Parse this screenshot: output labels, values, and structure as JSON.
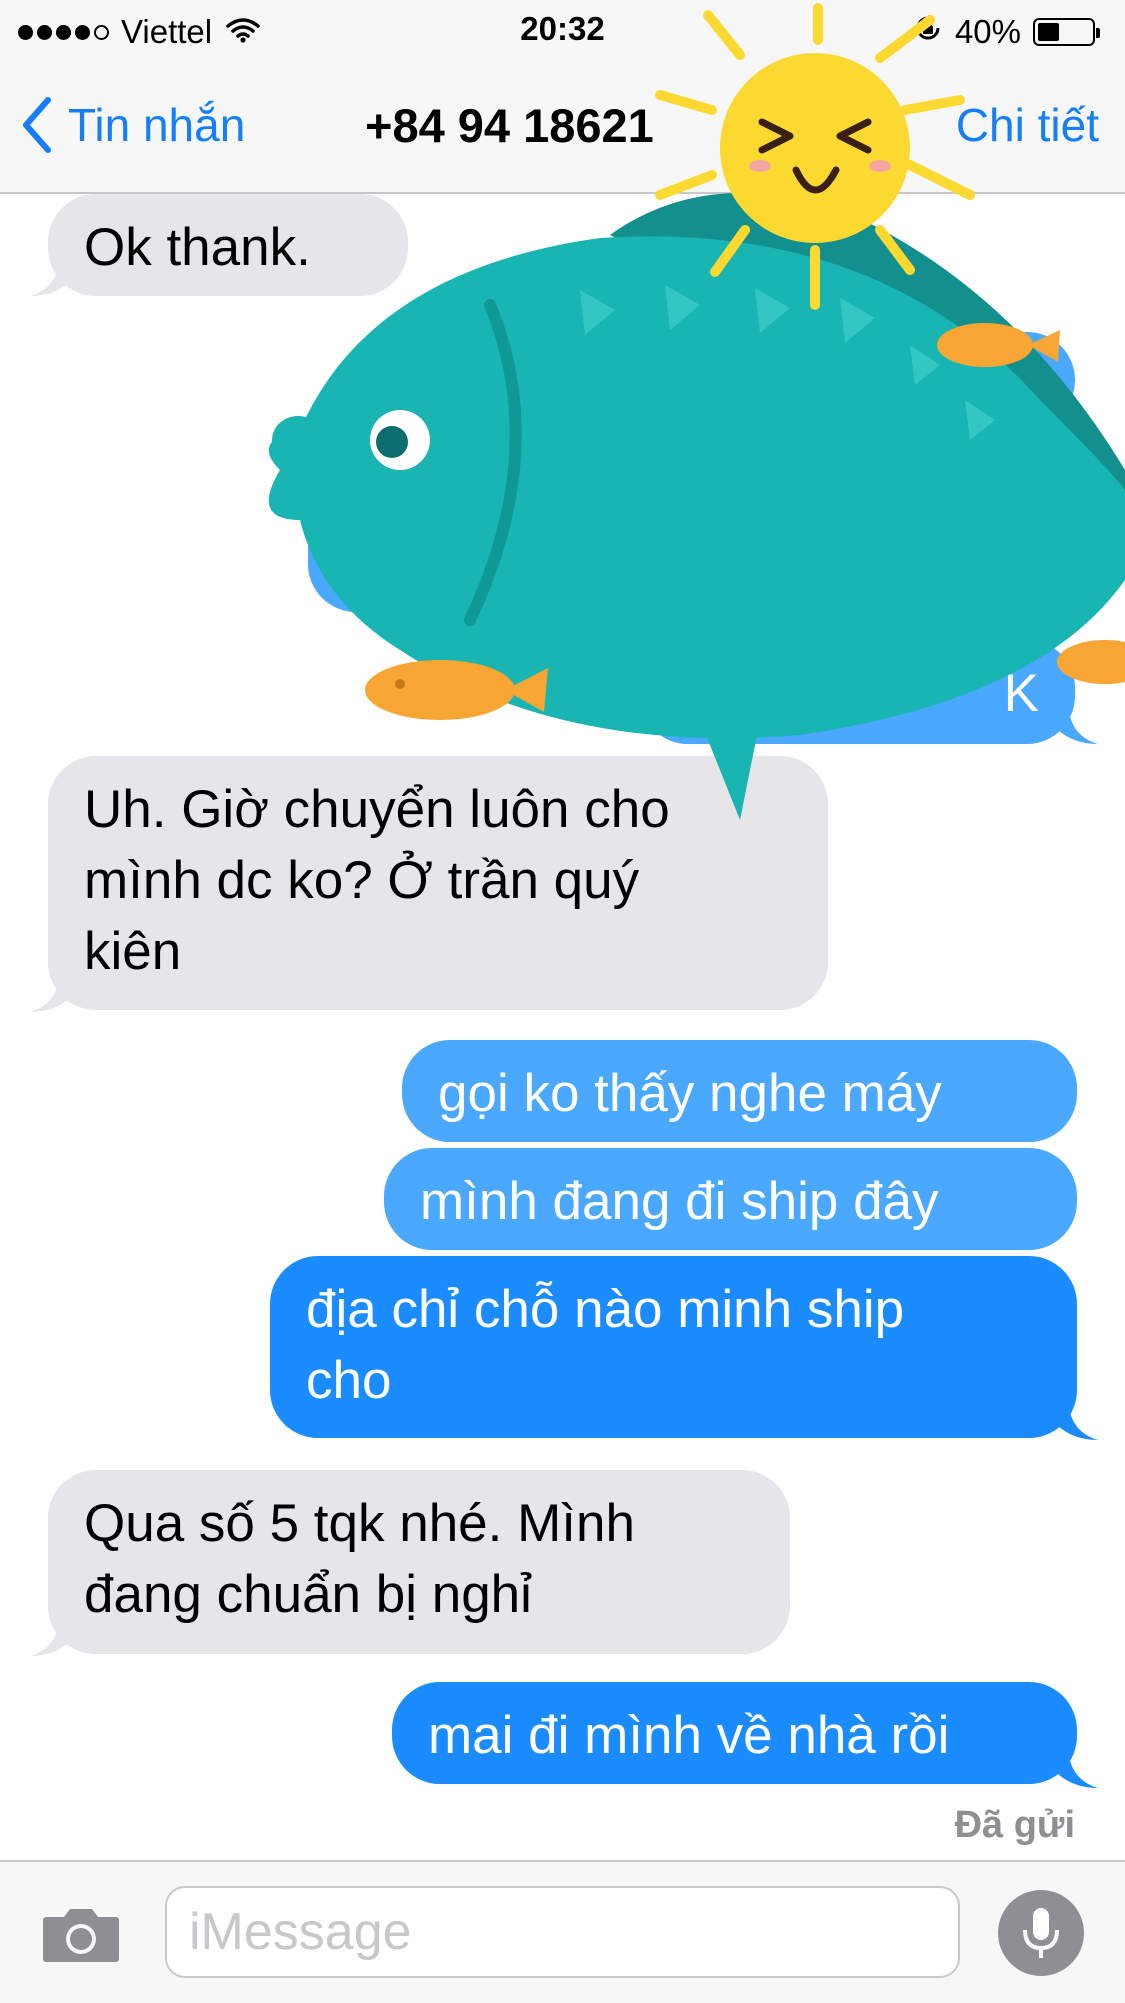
{
  "status_bar": {
    "carrier": "Viettel",
    "time": "20:32",
    "battery_percent": "40%",
    "battery_level": 0.4,
    "signal_bars_filled": 4,
    "signal_bars_total": 5
  },
  "nav": {
    "back_label": "Tin nhắn",
    "title": "+84 94 18621",
    "detail_label": "Chi tiết"
  },
  "messages": [
    {
      "direction": "incoming",
      "text": "Ok thank."
    },
    {
      "direction": "incoming",
      "lines": [
        "Uh. Giờ chuyển luôn cho",
        "mình dc ko? Ở trần quý",
        "kiên"
      ]
    },
    {
      "direction": "outgoing",
      "text": "gọi ko thấy nghe máy"
    },
    {
      "direction": "outgoing",
      "text": "mình đang đi ship đây"
    },
    {
      "direction": "outgoing",
      "lines": [
        "địa chỉ chỗ nào minh ship",
        "cho"
      ]
    },
    {
      "direction": "incoming",
      "lines": [
        "Qua số 5 tqk nhé. Mình",
        "đang chuẩn bị nghỉ"
      ]
    },
    {
      "direction": "outgoing",
      "text": "mai đi mình về nhà rồi"
    }
  ],
  "hidden_bubble_fragments": {
    "partial_text": "K"
  },
  "delivered_label": "Đã gửi",
  "input": {
    "placeholder": "iMessage"
  },
  "colors": {
    "accent": "#157efb",
    "incoming_bubble": "#e5e5ea",
    "outgoing_bubble": "#4aa8ff",
    "fish": "#18b5b3",
    "sun": "#fcd931"
  },
  "icons": {
    "back": "chevron-left-icon",
    "camera": "camera-icon",
    "mic": "microphone-icon",
    "wifi": "wifi-icon",
    "rotation_lock": "rotation-lock-icon",
    "sticker_fish": "fish-sticker",
    "sticker_sun": "sun-sticker"
  }
}
